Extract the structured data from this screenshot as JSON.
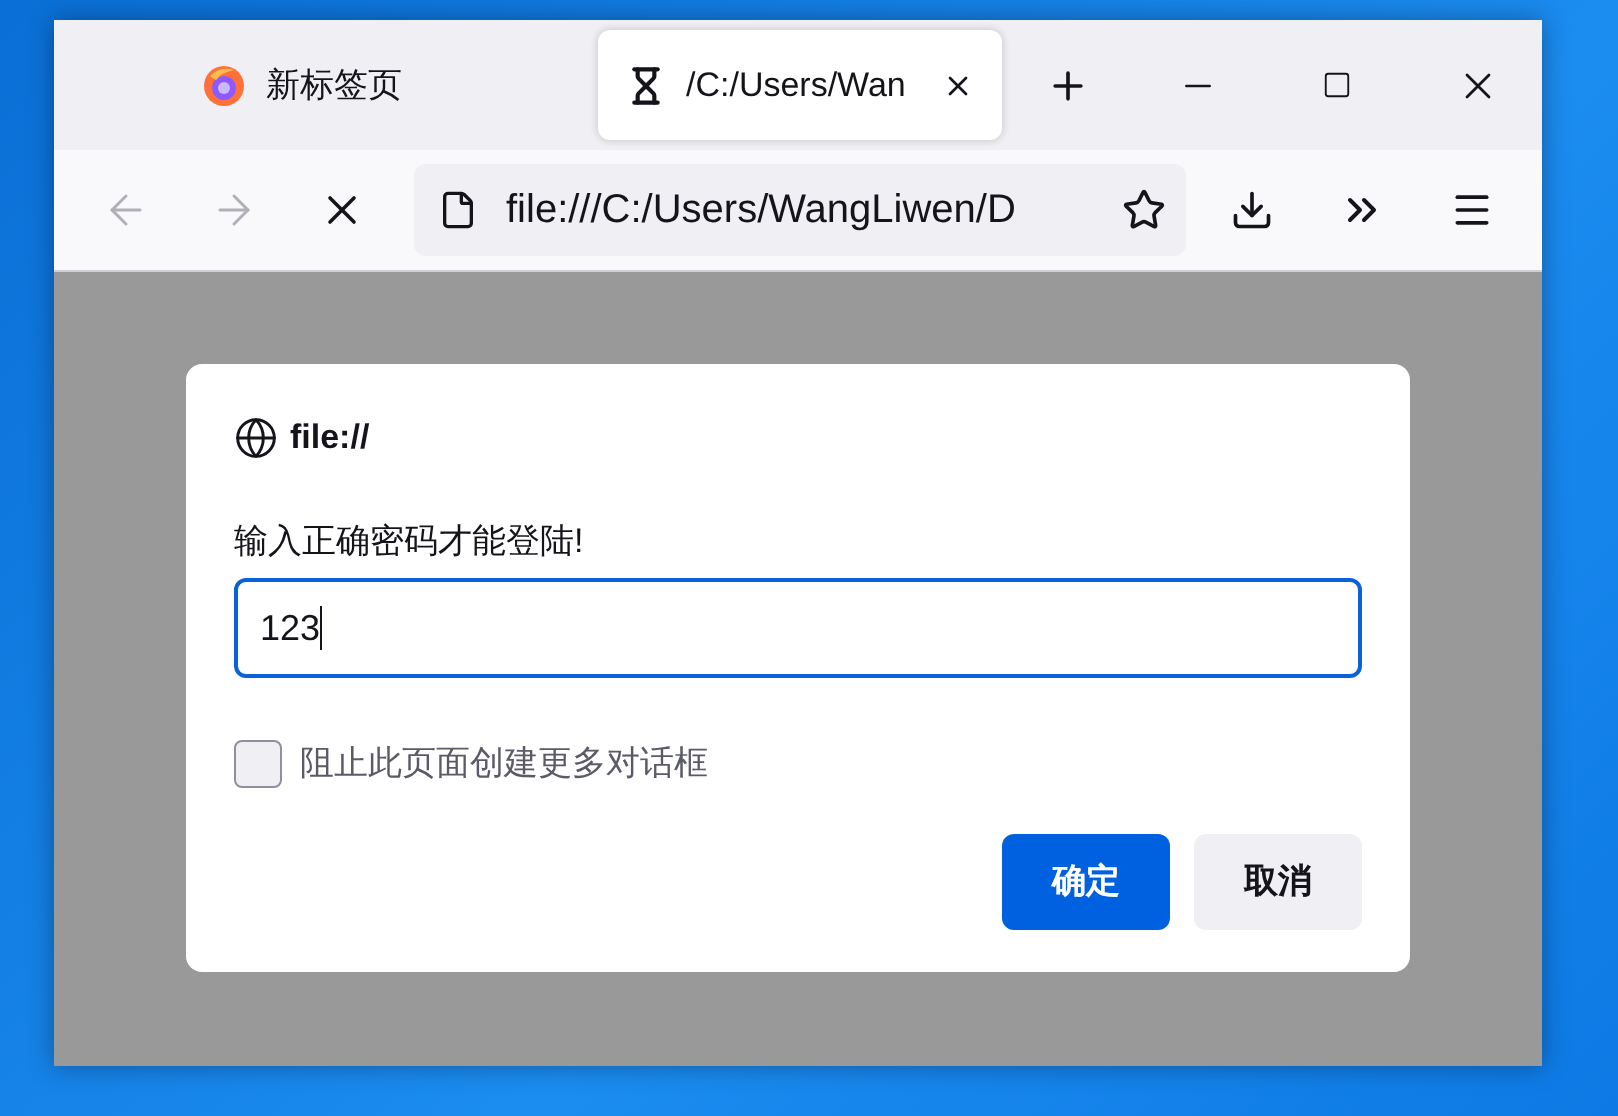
{
  "browser": {
    "tabs": [
      {
        "title": "新标签页",
        "selected": false,
        "kind": "firefox"
      },
      {
        "title": "/C:/Users/Wan",
        "selected": true,
        "kind": "loading"
      }
    ],
    "nav": {
      "back_disabled": true,
      "forward_disabled": true,
      "loading": true
    },
    "address": "file:///C:/Users/WangLiwen/D"
  },
  "dialog": {
    "origin": "file://",
    "message": "输入正确密码才能登陆!",
    "value": "123",
    "checkbox": {
      "label": "阻止此页面创建更多对话框",
      "checked": false
    },
    "buttons": [
      {
        "label": "确定",
        "kind": "primary"
      },
      {
        "label": "取消",
        "kind": "secondary"
      }
    ]
  }
}
